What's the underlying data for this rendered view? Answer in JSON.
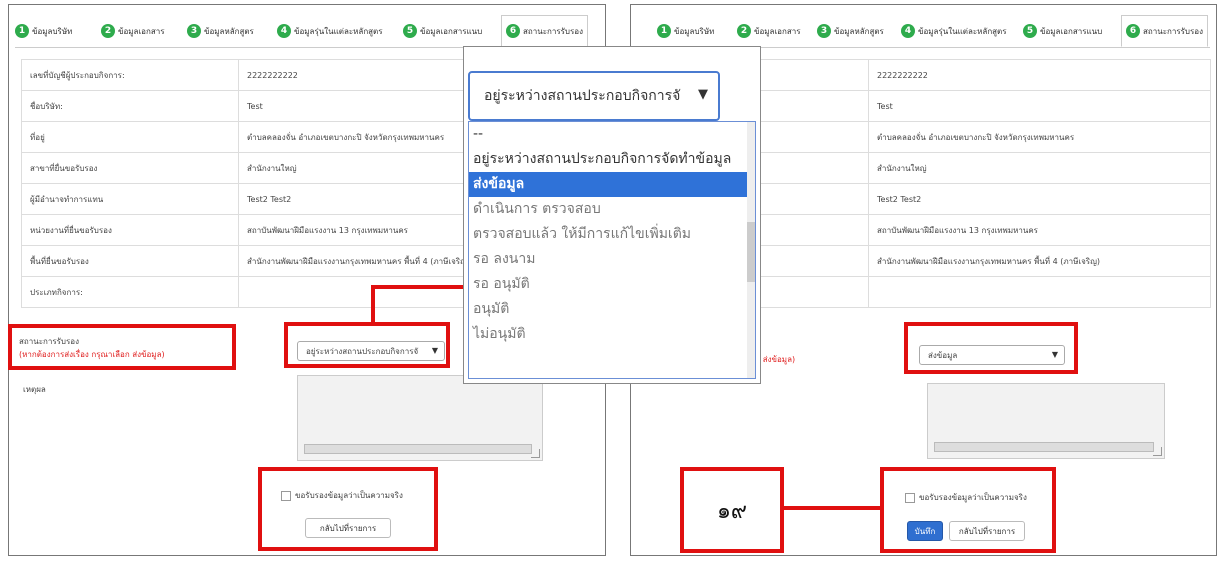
{
  "tabs": [
    {
      "num": "1",
      "label": "ข้อมูลบริษัท"
    },
    {
      "num": "2",
      "label": "ข้อมูลเอกสาร"
    },
    {
      "num": "3",
      "label": "ข้อมูลหลักสูตร"
    },
    {
      "num": "4",
      "label": "ข้อมูลรุ่นในแต่ละหลักสูตร"
    },
    {
      "num": "5",
      "label": "ข้อมูลเอกสารแนบ"
    },
    {
      "num": "6",
      "label": "สถานะการรับรอง"
    }
  ],
  "info_rows": [
    {
      "label": "เลขที่บัญชีผู้ประกอบกิจการ:",
      "value": "2222222222"
    },
    {
      "label": "ชื่อบริษัท:",
      "value": "Test"
    },
    {
      "label": "ที่อยู่",
      "value": "ตำบลคลองจั่น อำเภอเขตบางกะปิ จังหวัดกรุงเทพมหานคร"
    },
    {
      "label": "สาขาที่ยื่นขอรับรอง",
      "value": "สำนักงานใหญ่"
    },
    {
      "label": "ผู้มีอำนาจทำการแทน",
      "value": "Test2 Test2"
    },
    {
      "label": "หน่วยงานที่ยื่นขอรับรอง",
      "value": "สถาบันพัฒนาฝีมือแรงงาน 13 กรุงเทพมหานคร"
    },
    {
      "label": "พื้นที่ยื่นขอรับรอง",
      "value": "สำนักงานพัฒนาฝีมือแรงงานกรุงเทพมหานคร พื้นที่ 4 (ภาษีเจริญ)"
    },
    {
      "label": "ประเภทกิจการ:",
      "value": ""
    }
  ],
  "status": {
    "label": "สถานะการรับรอง",
    "note": "(หากต้องการส่งเรื่อง กรุณาเลือก ส่งข้อมูล)",
    "note_partial": "ณาเลือก ส่งข้อมูล)",
    "left_value": "อยู่ระหว่างสถานประกอบกิจการจั",
    "right_value": "ส่งข้อมูล"
  },
  "reason_label": "เหตุผล",
  "certify_checkbox_label": "ขอรับรองข้อมูลว่าเป็นความจริง",
  "back_button": "กลับไปที่รายการ",
  "save_button": "บันทึก",
  "dropdown": {
    "current": "อยู่ระหว่างสถานประกอบกิจการจั",
    "options": [
      "--",
      "อยู่ระหว่างสถานประกอบกิจการจัดทำข้อมูล",
      "ส่งข้อมูล",
      "ดำเนินการ ตรวจสอบ",
      "ตรวจสอบแล้ว ให้มีการแก้ไขเพิ่มเติม",
      "รอ ลงนาม",
      "รอ อนุมัติ",
      "อนุมัติ",
      "ไม่อนุมัติ"
    ],
    "selected_index": 2
  },
  "annotation_number": "๑๙",
  "colors": {
    "highlight": "#e01010",
    "tab_badge": "#2eab4c",
    "selected_option": "#2f72d8",
    "primary_button": "#2f6fd0"
  }
}
